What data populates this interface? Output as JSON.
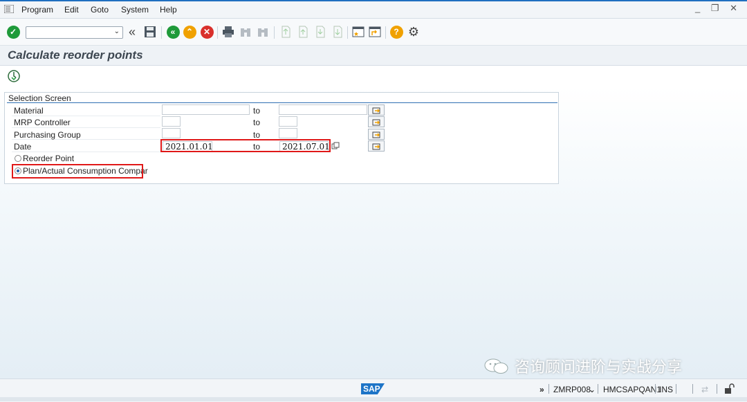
{
  "menu": {
    "items": [
      "Program",
      "Edit",
      "Goto",
      "System",
      "Help"
    ],
    "window_controls": "_ ❐ ✕"
  },
  "toolbar": {
    "command_value": ""
  },
  "page": {
    "title": "Calculate reorder points"
  },
  "selection": {
    "frame_title": "Selection Screen",
    "to_label": "to",
    "rows": [
      {
        "label": "Material",
        "from": "",
        "to": ""
      },
      {
        "label": "MRP Controller",
        "from": "",
        "to": ""
      },
      {
        "label": "Purchasing Group",
        "from": "",
        "to": ""
      },
      {
        "label": "Date",
        "from": "2021.01.01",
        "to": "2021.07.01"
      }
    ],
    "radios": [
      {
        "label": "Reorder Point",
        "selected": false
      },
      {
        "label": "Plan/Actual Consumption Compar",
        "selected": true
      }
    ]
  },
  "watermark": {
    "text": "咨询顾问进阶与实战分享"
  },
  "status": {
    "logo": "SAP",
    "chevrons": "»",
    "transaction": "ZMRP008",
    "dropdown": "⌄",
    "system": "HMCSAPQAN1",
    "mode": "INS"
  },
  "colors": {
    "accent": "#1f6fc0",
    "ok_green": "#1f9a3a",
    "cancel_red": "#d9302c",
    "exit_orange": "#f0a100",
    "highlight_red": "#e01818"
  }
}
